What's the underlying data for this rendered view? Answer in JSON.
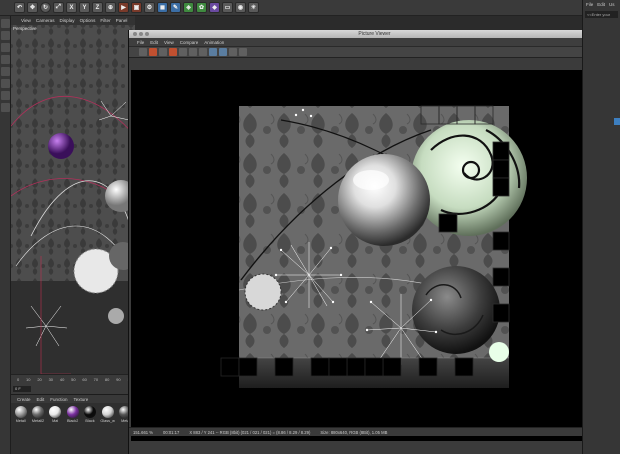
{
  "app": {
    "toolbar_icons": [
      "undo-icon",
      "move-icon",
      "scale-icon",
      "rotate-icon",
      "x-axis",
      "y-axis",
      "z-axis",
      "coord-icon",
      "render-icon",
      "render-view-icon",
      "render-settings-icon",
      "cube-icon",
      "pen-icon",
      "subdivide-icon",
      "array-icon",
      "deformer-icon",
      "floor-icon",
      "camera-icon",
      "light-icon"
    ],
    "axis_labels": {
      "x": "X",
      "y": "Y",
      "z": "Z"
    }
  },
  "viewport": {
    "menu": [
      "View",
      "Cameras",
      "Display",
      "Options",
      "Filter",
      "Panel"
    ],
    "label": "Perspective"
  },
  "timeline": {
    "ticks": [
      "0",
      "10",
      "20",
      "30",
      "40",
      "50",
      "60",
      "70",
      "80",
      "90",
      "10"
    ],
    "current_frame": "0 F"
  },
  "materials": {
    "menu": [
      "Create",
      "Edit",
      "Function",
      "Texture"
    ],
    "items": [
      {
        "name": "Metall",
        "color": "#9a9a9a"
      },
      {
        "name": "Metall2",
        "color": "#6a6a6a"
      },
      {
        "name": "Mat",
        "color": "#e8e8e8"
      },
      {
        "name": "Black2",
        "color": "#7a2fa0"
      },
      {
        "name": "Black",
        "color": "#0a0a0a"
      },
      {
        "name": "Glass_w",
        "color": "#d4d4d4"
      },
      {
        "name": "Meta",
        "color": "#555555"
      }
    ]
  },
  "picture_viewer": {
    "title": "Picture Viewer",
    "menu": [
      "File",
      "Edit",
      "View",
      "Compare",
      "Animation"
    ],
    "status": {
      "zoom": "151.661 %",
      "time": "00:01:17",
      "coords": "X 883 / Y 241 -- RGB (8bit) (021 / 021 / 021) = (8.86 / 8.29 / 8.29)",
      "size": "Size: 880x640, RGB (8Bit), 1.05 MB"
    }
  },
  "attributes": {
    "menu": [
      "File",
      "Edit",
      "Us"
    ],
    "search_placeholder": "<<Enter your"
  }
}
